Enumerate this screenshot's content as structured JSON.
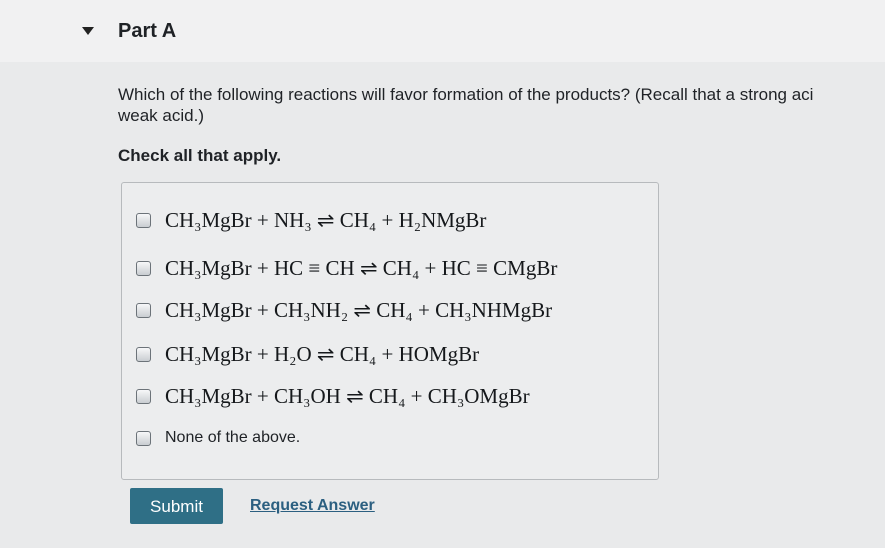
{
  "part": {
    "title": "Part A"
  },
  "question": {
    "line1": "Which of the following reactions will favor formation of the products? (Recall that a strong aci",
    "line2": "weak acid.)"
  },
  "instruction": "Check all that apply.",
  "choices": [
    {
      "label": "CH₃MgBr + NH₃ ⇌ CH₄ + H₂NMgBr",
      "checked": false
    },
    {
      "label": "CH₃MgBr + HC ≡ CH ⇌ CH₄ + HC ≡ CMgBr",
      "checked": false
    },
    {
      "label": "CH₃MgBr + CH₃NH₂ ⇌ CH₄ + CH₃NHMgBr",
      "checked": false
    },
    {
      "label": "CH₃MgBr + H₂O ⇌ CH₄ + HOMgBr",
      "checked": false
    },
    {
      "label": "CH₃MgBr + CH₃OH ⇌ CH₄ + CH₃OMgBr",
      "checked": false
    },
    {
      "label": "None of the above.",
      "checked": false
    }
  ],
  "actions": {
    "submit_label": "Submit",
    "request_label": "Request Answer"
  }
}
